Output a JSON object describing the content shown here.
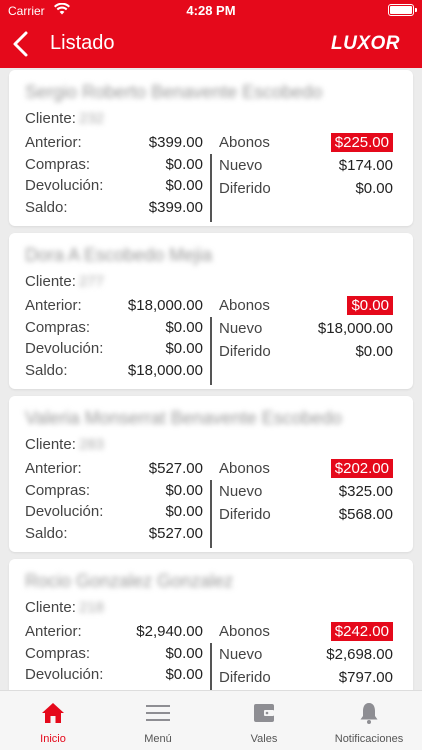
{
  "status_bar": {
    "carrier": "Carrier",
    "time": "4:28 PM"
  },
  "header": {
    "title": "Listado",
    "logo": "LUXOR"
  },
  "labels": {
    "cliente": "Cliente:",
    "anterior": "Anterior:",
    "compras": "Compras:",
    "devolucion": "Devolución:",
    "saldo": "Saldo:",
    "abonos": "Abonos",
    "nuevo": "Nuevo",
    "diferido": "Diferido"
  },
  "cards": [
    {
      "name": "Sergio Roberto Benavente Escobedo",
      "client_number": "232",
      "anterior": "$399.00",
      "compras": "$0.00",
      "devolucion": "$0.00",
      "saldo": "$399.00",
      "abonos": "$225.00",
      "nuevo": "$174.00",
      "diferido": "$0.00"
    },
    {
      "name": "Dora A Escobedo Mejia",
      "client_number": "277",
      "anterior": "$18,000.00",
      "compras": "$0.00",
      "devolucion": "$0.00",
      "saldo": "$18,000.00",
      "abonos": "$0.00",
      "nuevo": "$18,000.00",
      "diferido": "$0.00"
    },
    {
      "name": "Valeria Monserrat Benavente Escobedo",
      "client_number": "283",
      "anterior": "$527.00",
      "compras": "$0.00",
      "devolucion": "$0.00",
      "saldo": "$527.00",
      "abonos": "$202.00",
      "nuevo": "$325.00",
      "diferido": "$568.00"
    },
    {
      "name": "Rocio Gonzalez Gonzalez",
      "client_number": "218",
      "anterior": "$2,940.00",
      "compras": "$0.00",
      "devolucion": "$0.00",
      "saldo": "",
      "abonos": "$242.00",
      "nuevo": "$2,698.00",
      "diferido": "$797.00"
    }
  ],
  "tabs": [
    {
      "label": "Inicio",
      "icon": "home-icon",
      "active": true
    },
    {
      "label": "Menú",
      "icon": "menu-icon",
      "active": false
    },
    {
      "label": "Vales",
      "icon": "wallet-icon",
      "active": false
    },
    {
      "label": "Notificaciones",
      "icon": "bell-icon",
      "active": false
    }
  ],
  "colors": {
    "brand_red": "#e5091b",
    "active_tab": "#e5091b",
    "inactive_tab": "#8e8e93"
  }
}
